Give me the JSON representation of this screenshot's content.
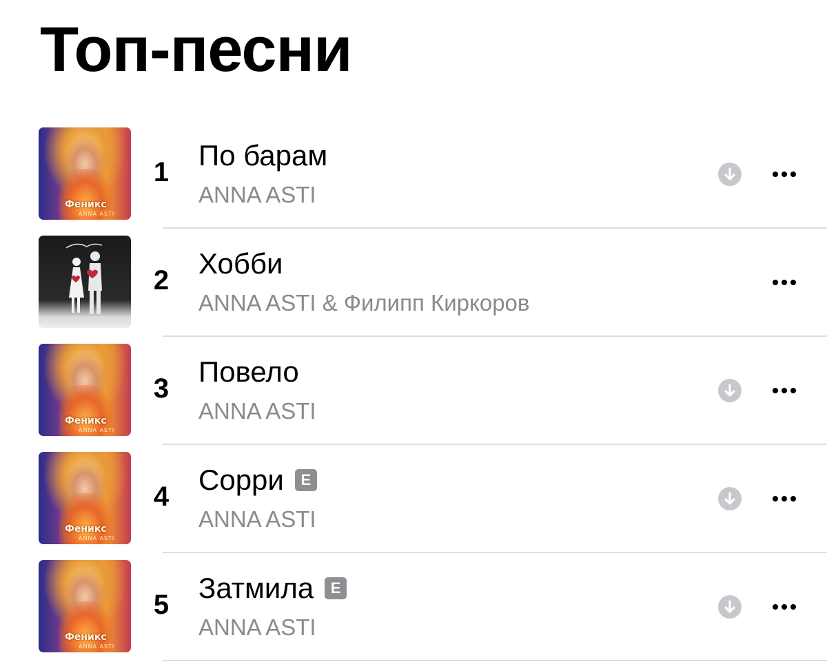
{
  "header": {
    "title": "Топ-песни"
  },
  "tracks": [
    {
      "number": "1",
      "title": "По барам",
      "artist": "ANNA ASTI",
      "explicit": false,
      "downloadable": true,
      "artwork": "fenix",
      "artwork_text": "Феникс",
      "artwork_sub": "ANNA ASTI"
    },
    {
      "number": "2",
      "title": "Хобби",
      "artist": "ANNA ASTI & Филипп Киркоров",
      "explicit": false,
      "downloadable": false,
      "artwork": "hobby",
      "artwork_text": "",
      "artwork_sub": ""
    },
    {
      "number": "3",
      "title": "Повело",
      "artist": "ANNA ASTI",
      "explicit": false,
      "downloadable": true,
      "artwork": "fenix",
      "artwork_text": "Феникс",
      "artwork_sub": "ANNA ASTI"
    },
    {
      "number": "4",
      "title": "Сорри",
      "artist": "ANNA ASTI",
      "explicit": true,
      "downloadable": true,
      "artwork": "fenix",
      "artwork_text": "Феникс",
      "artwork_sub": "ANNA ASTI"
    },
    {
      "number": "5",
      "title": "Затмила",
      "artist": "ANNA ASTI",
      "explicit": true,
      "downloadable": true,
      "artwork": "fenix",
      "artwork_text": "Феникс",
      "artwork_sub": "ANNA ASTI"
    }
  ],
  "explicit_label": "E",
  "icons": {
    "download": "download-circle-icon",
    "more": "ellipsis-icon"
  },
  "colors": {
    "text_primary": "#000000",
    "text_secondary": "#8a8a8e",
    "explicit_badge": "#8e8e93",
    "download_icon": "#c7c7cc",
    "separator": "#dedede"
  }
}
